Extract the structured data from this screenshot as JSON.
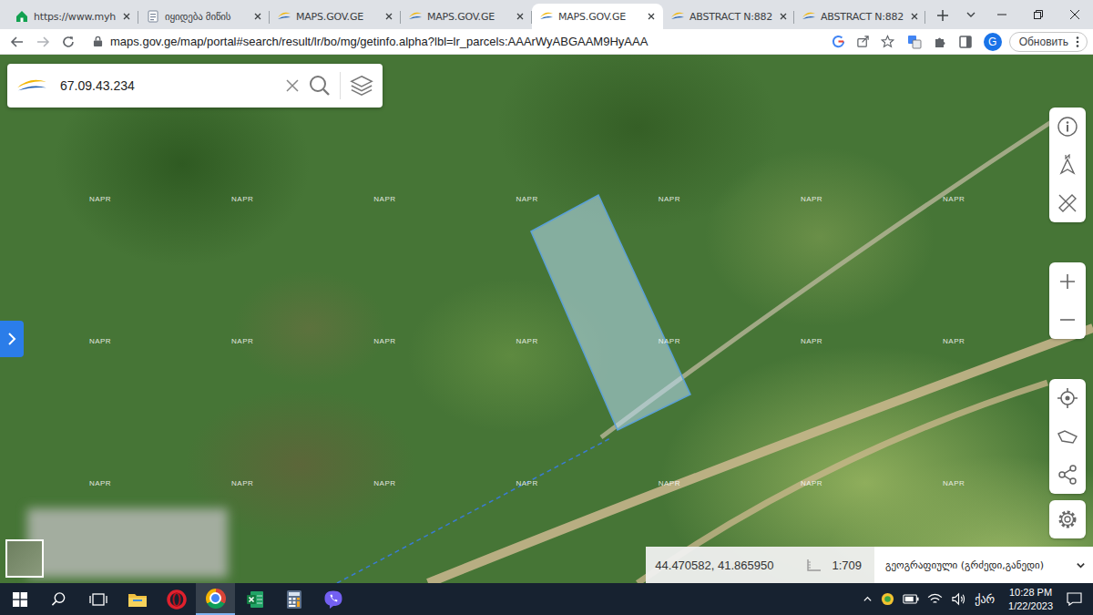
{
  "browser": {
    "tabs": [
      {
        "label": "https://www.myh",
        "kind": "myhome",
        "selected": false
      },
      {
        "label": "იყიდება მიწის",
        "kind": "document",
        "selected": false
      },
      {
        "label": "MAPS.GOV.GE",
        "kind": "maps",
        "selected": false
      },
      {
        "label": "MAPS.GOV.GE",
        "kind": "maps",
        "selected": false
      },
      {
        "label": "MAPS.GOV.GE",
        "kind": "maps",
        "selected": true
      },
      {
        "label": "ABSTRACT N:882",
        "kind": "maps",
        "selected": false
      },
      {
        "label": "ABSTRACT N:882",
        "kind": "maps",
        "selected": false
      }
    ],
    "url": "maps.gov.ge/map/portal#search/result/lr/bo/mg/getinfo.alpha?lbl=lr_parcels:AAArWyABGAAM9HyAAA",
    "profile_initial": "G",
    "update_button": "Обновить"
  },
  "map": {
    "search_value": "67.09.43.234",
    "watermark": "NAPR",
    "coordinates": "44.470582, 41.865950",
    "scale": "1:709",
    "coordinate_system": "გეოგრაფიული (გრძედი,განედი)"
  },
  "taskbar": {
    "apps": [
      {
        "kind": "explorer",
        "active": false
      },
      {
        "kind": "opera",
        "active": false
      },
      {
        "kind": "chrome",
        "active": true
      },
      {
        "kind": "excel",
        "active": false
      },
      {
        "kind": "calculator",
        "active": false
      },
      {
        "kind": "viber",
        "active": false
      }
    ],
    "language": "ქარ",
    "time": "10:28 PM",
    "date": "1/22/2023"
  }
}
